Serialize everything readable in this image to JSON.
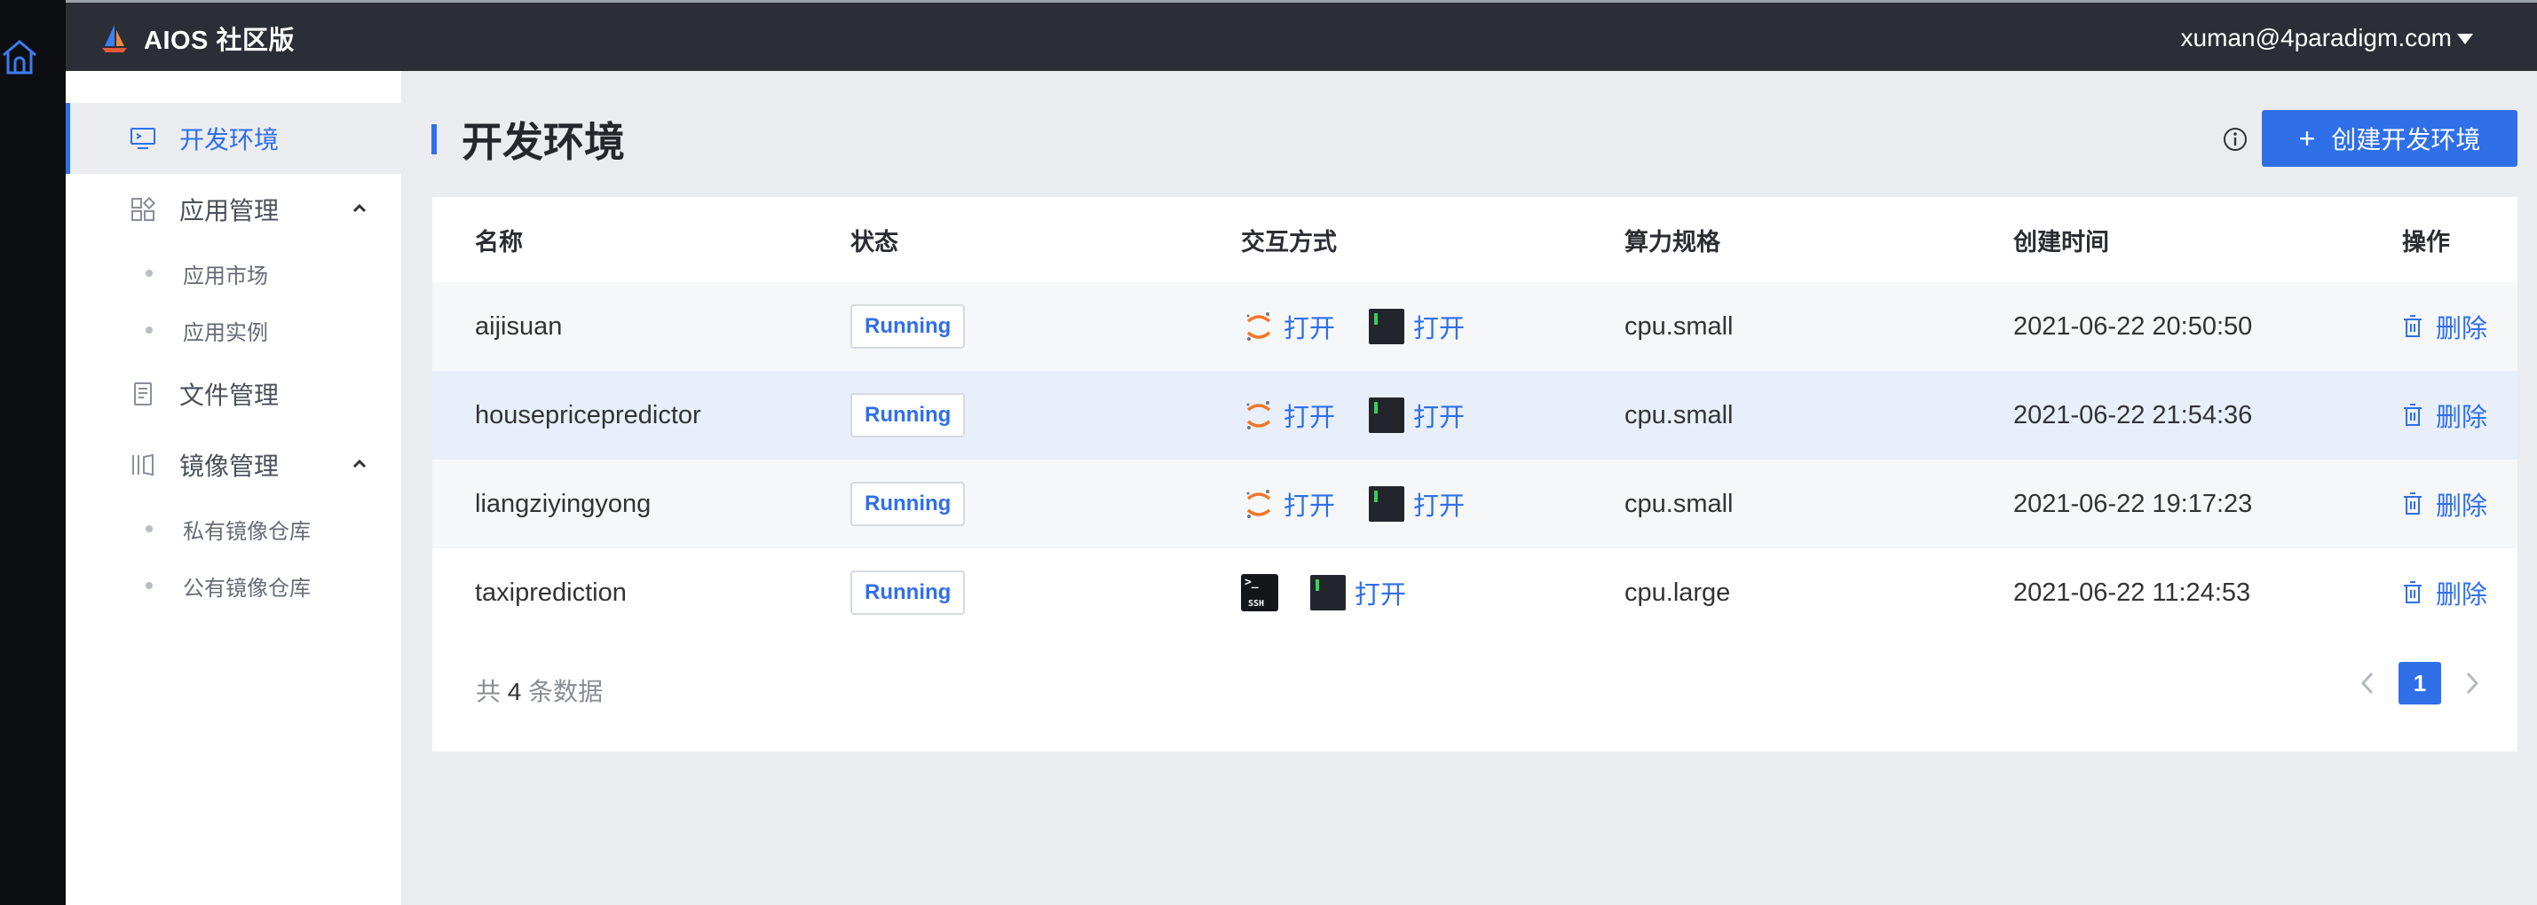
{
  "header": {
    "app_title": "AIOS 社区版",
    "user_email": "xuman@4paradigm.com"
  },
  "sidebar": {
    "items": [
      {
        "label": "开发环境",
        "icon": "monitor-icon",
        "active": true
      },
      {
        "label": "应用管理",
        "icon": "apps-icon",
        "expanded": true,
        "children": [
          {
            "label": "应用市场"
          },
          {
            "label": "应用实例"
          }
        ]
      },
      {
        "label": "文件管理",
        "icon": "file-icon"
      },
      {
        "label": "镜像管理",
        "icon": "image-icon",
        "expanded": true,
        "children": [
          {
            "label": "私有镜像仓库"
          },
          {
            "label": "公有镜像仓库"
          }
        ]
      }
    ]
  },
  "page": {
    "title": "开发环境",
    "create_button": "创建开发环境"
  },
  "table": {
    "columns": [
      "名称",
      "状态",
      "交互方式",
      "算力规格",
      "创建时间",
      "操作"
    ],
    "rows": [
      {
        "name": "aijisuan",
        "status": "Running",
        "jupyter_link": "打开",
        "terminal_link": "打开",
        "spec": "cpu.small",
        "created": "2021-06-22 20:50:50",
        "action": "删除"
      },
      {
        "name": "housepricepredictor",
        "status": "Running",
        "jupyter_link": "打开",
        "terminal_link": "打开",
        "spec": "cpu.small",
        "created": "2021-06-22 21:54:36",
        "action": "删除"
      },
      {
        "name": "liangziyingyong",
        "status": "Running",
        "jupyter_link": "打开",
        "terminal_link": "打开",
        "spec": "cpu.small",
        "created": "2021-06-22 19:17:23",
        "action": "删除"
      },
      {
        "name": "taxiprediction",
        "status": "Running",
        "ssh_icon": "ssh-icon",
        "terminal_link": "打开",
        "spec": "cpu.large",
        "created": "2021-06-22 11:24:53",
        "action": "删除"
      }
    ]
  },
  "footer": {
    "total_prefix": "共",
    "total_count": "4",
    "total_suffix": "条数据",
    "current_page": "1"
  },
  "colors": {
    "accent": "#2f6fe8",
    "topbar": "#2b2e37",
    "launcher": "#0d0e12"
  }
}
